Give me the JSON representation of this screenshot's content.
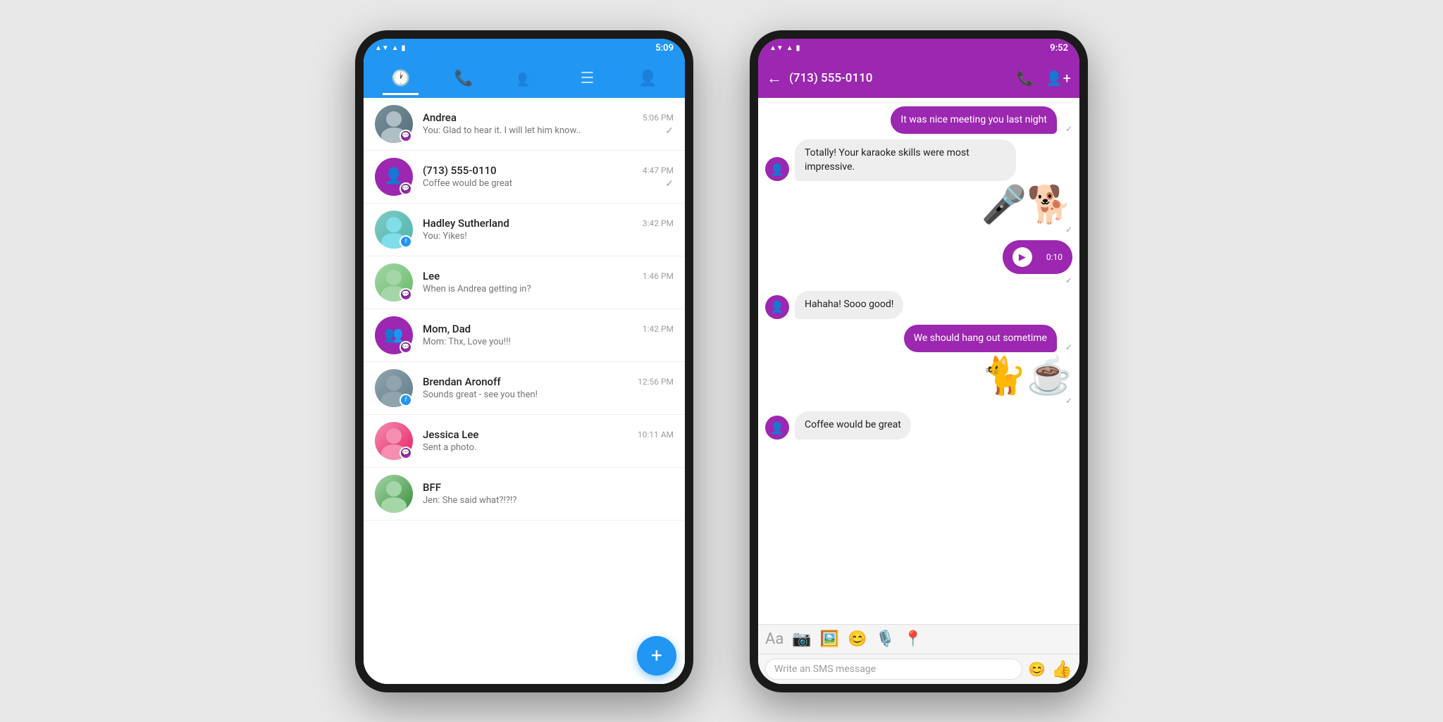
{
  "phone1": {
    "status": {
      "time": "5:09",
      "wifi": "▲▼",
      "signal": "▲",
      "battery": "▮"
    },
    "tabs": [
      {
        "icon": "🕐",
        "active": true
      },
      {
        "icon": "📞",
        "active": false
      },
      {
        "icon": "👥",
        "active": false
      },
      {
        "icon": "☰",
        "active": false
      },
      {
        "icon": "👤",
        "active": false
      }
    ],
    "chats": [
      {
        "name": "Andrea",
        "time": "5:06 PM",
        "preview": "You: Glad to hear it. I will let him know..",
        "badge_color": "purple",
        "avatar_type": "photo_andrea"
      },
      {
        "name": "(713) 555-0110",
        "time": "4:47 PM",
        "preview": "Coffee would be great",
        "badge_color": "purple",
        "avatar_type": "icon_person"
      },
      {
        "name": "Hadley Sutherland",
        "time": "3:42 PM",
        "preview": "You: Yikes!",
        "badge_color": "blue",
        "avatar_type": "photo_hadley"
      },
      {
        "name": "Lee",
        "time": "1:46 PM",
        "preview": "When is Andrea getting in?",
        "badge_color": "purple",
        "avatar_type": "photo_lee"
      },
      {
        "name": "Mom, Dad",
        "time": "1:42 PM",
        "preview": "Mom: Thx, Love you!!!",
        "badge_color": "purple",
        "avatar_type": "icon_people"
      },
      {
        "name": "Brendan Aronoff",
        "time": "12:56 PM",
        "preview": "Sounds great - see you then!",
        "badge_color": "blue",
        "avatar_type": "photo_brendan"
      },
      {
        "name": "Jessica Lee",
        "time": "10:11 AM",
        "preview": "Sent a photo.",
        "badge_color": "purple",
        "avatar_type": "photo_jessica"
      },
      {
        "name": "BFF",
        "time": "",
        "preview": "Jen: She said what?!?!?",
        "badge_color": "none",
        "avatar_type": "photo_bff"
      }
    ],
    "fab_label": "+"
  },
  "phone2": {
    "status": {
      "time": "9:52"
    },
    "header": {
      "back": "←",
      "contact": "(713) 555-0110",
      "call_icon": "📞",
      "add_contact_icon": "👤+"
    },
    "messages": [
      {
        "type": "sent",
        "text": "It was nice meeting you last night",
        "checked": true
      },
      {
        "type": "received",
        "text": "Totally! Your karaoke skills were most impressive.",
        "checked": false
      },
      {
        "type": "sticker_sent",
        "emoji": "🎤🐕",
        "checked": true
      },
      {
        "type": "voice_sent",
        "duration": "0:10",
        "checked": true
      },
      {
        "type": "received",
        "text": "Hahaha! Sooo good!",
        "checked": false
      },
      {
        "type": "sent",
        "text": "We should hang out sometime",
        "checked": true
      },
      {
        "type": "sticker_sent",
        "emoji": "🐈☕",
        "checked": true
      },
      {
        "type": "received",
        "text": "Coffee would be great",
        "checked": false
      }
    ],
    "input_bar": {
      "placeholder": "Write an SMS message",
      "icons": [
        "Aa",
        "📷",
        "🖼️",
        "😊",
        "🎙️",
        "📍"
      ]
    },
    "emoji_bar": [
      "😊",
      "👍"
    ]
  }
}
